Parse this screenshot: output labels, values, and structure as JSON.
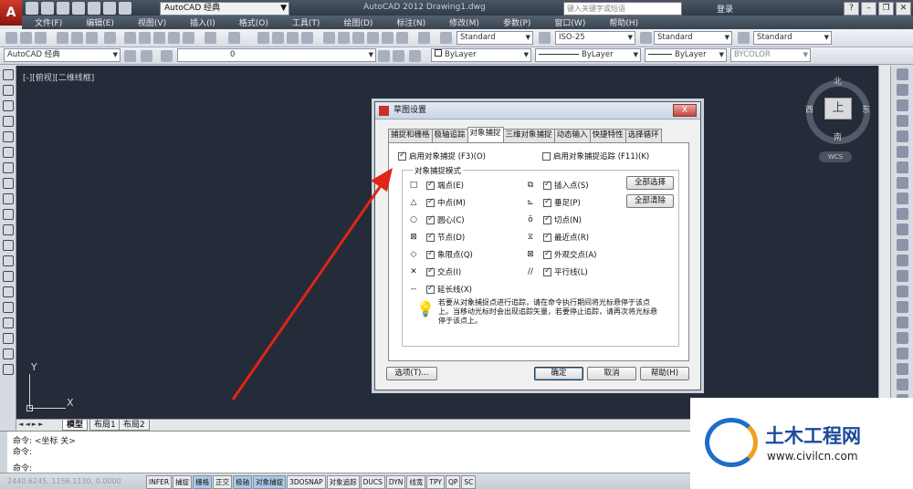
{
  "title_bar": {
    "logo": "A",
    "workspace": "AutoCAD 经典",
    "window_title": "AutoCAD 2012  Drawing1.dwg",
    "search_placeholder": "键入关键字或短语",
    "login": "登录",
    "help": "?"
  },
  "menu": [
    "文件(F)",
    "编辑(E)",
    "视图(V)",
    "插入(I)",
    "格式(O)",
    "工具(T)",
    "绘图(D)",
    "标注(N)",
    "修改(M)",
    "参数(P)",
    "窗口(W)",
    "帮助(H)"
  ],
  "toolbar": {
    "text_style": "Standard",
    "dim_style": "ISO-25",
    "table_style": "Standard",
    "mleader_style": "Standard",
    "workspace2": "AutoCAD 经典",
    "layer": "0",
    "color": "ByLayer",
    "linetype": "ByLayer",
    "lineweight": "ByLayer",
    "plotstyle": "BYCOLOR"
  },
  "viewport_label": "[-][俯视][二维线框]",
  "viewcube": {
    "north": "北",
    "south": "南",
    "east": "东",
    "west": "西",
    "top": "上",
    "wcs": "WCS"
  },
  "ucs": {
    "x": "X",
    "y": "Y"
  },
  "layout_tabs": {
    "arrows": "◄◄►►",
    "model": "模型",
    "layout1": "布局1",
    "layout2": "布局2"
  },
  "command": {
    "line1": "命令:  <坐标 关>",
    "line2": "命令:",
    "line3": "命令:"
  },
  "status": {
    "coords": "2440.6245, 1156.1130, 0.0000",
    "toggles": [
      {
        "label": "INFER",
        "on": false
      },
      {
        "label": "捕捉",
        "on": false
      },
      {
        "label": "栅格",
        "on": true
      },
      {
        "label": "正交",
        "on": false
      },
      {
        "label": "极轴",
        "on": true
      },
      {
        "label": "对象捕捉",
        "on": true
      },
      {
        "label": "3DOSNAP",
        "on": false
      },
      {
        "label": "对象追踪",
        "on": false
      },
      {
        "label": "DUCS",
        "on": false
      },
      {
        "label": "DYN",
        "on": false
      },
      {
        "label": "线宽",
        "on": false
      },
      {
        "label": "TPY",
        "on": false
      },
      {
        "label": "QP",
        "on": false
      },
      {
        "label": "SC",
        "on": false
      }
    ]
  },
  "dialog": {
    "title": "草图设置",
    "close": "X",
    "tabs": [
      "捕捉和栅格",
      "极轴追踪",
      "对象捕捉",
      "三维对象捕捉",
      "动态输入",
      "快捷特性",
      "选择循环"
    ],
    "active_tab": 2,
    "enable_osnap": "启用对象捕捉 (F3)(O)",
    "enable_tracking": "启用对象捕捉追踪 (F11)(K)",
    "group_label": "对象捕捉模式",
    "modes_left": [
      {
        "sym": "□",
        "label": "端点(E)"
      },
      {
        "sym": "△",
        "label": "中点(M)"
      },
      {
        "sym": "○",
        "label": "圆心(C)"
      },
      {
        "sym": "⊠",
        "label": "节点(D)"
      },
      {
        "sym": "◇",
        "label": "象限点(Q)"
      },
      {
        "sym": "✕",
        "label": "交点(I)"
      },
      {
        "sym": "--",
        "label": "延长线(X)"
      }
    ],
    "modes_right": [
      {
        "sym": "⧉",
        "label": "插入点(S)"
      },
      {
        "sym": "⊾",
        "label": "垂足(P)"
      },
      {
        "sym": "ō",
        "label": "切点(N)"
      },
      {
        "sym": "⧖",
        "label": "最近点(R)"
      },
      {
        "sym": "⊠",
        "label": "外观交点(A)"
      },
      {
        "sym": "//",
        "label": "平行线(L)"
      }
    ],
    "select_all": "全部选择",
    "clear_all": "全部清除",
    "info": "若要从对象捕捉点进行追踪，请在命令执行期间将光标悬停于该点上。当移动光标时会出现追踪矢量，若要停止追踪，请再次将光标悬停于该点上。",
    "options": "选项(T)...",
    "ok": "确定",
    "cancel": "取消",
    "help": "帮助(H)"
  },
  "watermark": {
    "name": "土木工程网",
    "url": "www.civilcn.com"
  }
}
